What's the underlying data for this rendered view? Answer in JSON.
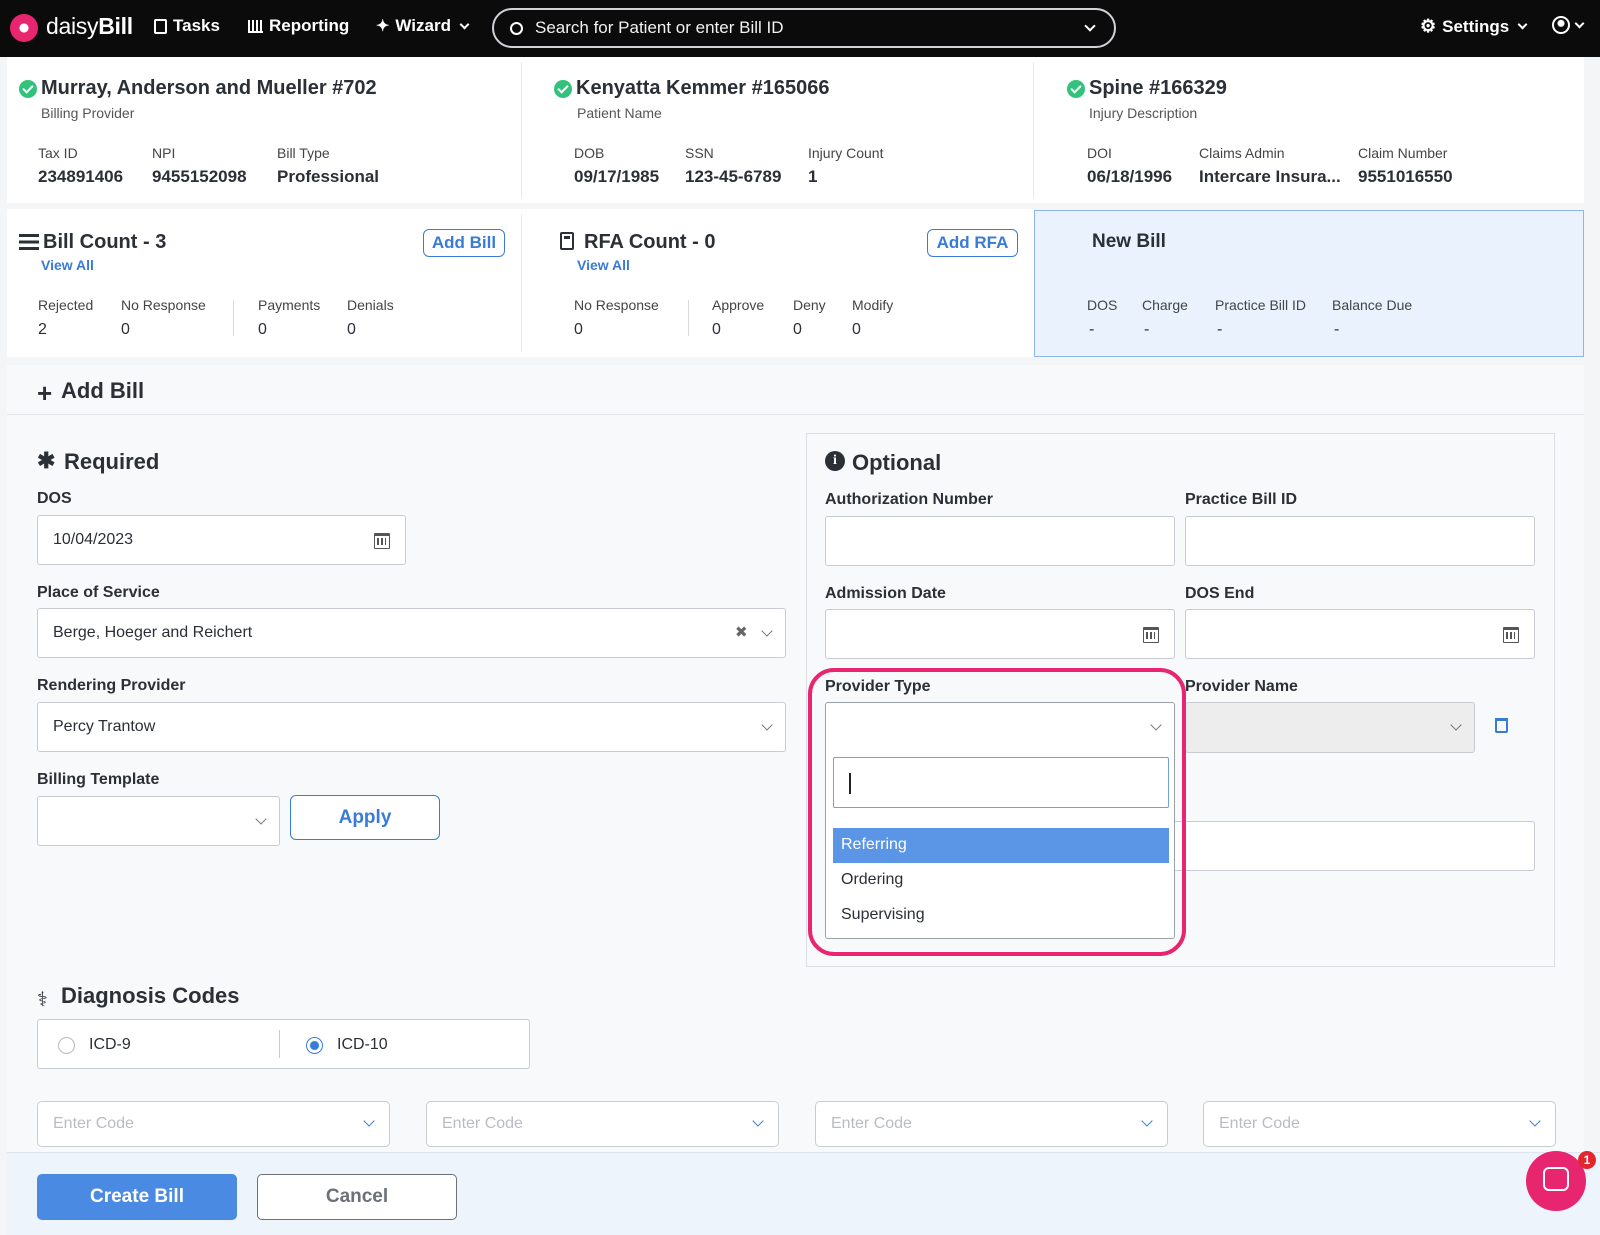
{
  "nav": {
    "brand_light": "daisy",
    "brand_bold": "Bill",
    "tasks": "Tasks",
    "reporting": "Reporting",
    "wizard": "Wizard",
    "search_placeholder": "Search for Patient or enter Bill ID",
    "settings": "Settings"
  },
  "summary": {
    "provider": {
      "title": "Murray, Anderson and Mueller #702",
      "subtitle": "Billing Provider",
      "fields": [
        {
          "label": "Tax ID",
          "value": "234891406"
        },
        {
          "label": "NPI",
          "value": "9455152098"
        },
        {
          "label": "Bill Type",
          "value": "Professional"
        }
      ]
    },
    "patient": {
      "title": "Kenyatta Kemmer #165066",
      "subtitle": "Patient Name",
      "fields": [
        {
          "label": "DOB",
          "value": "09/17/1985"
        },
        {
          "label": "SSN",
          "value": "123-45-6789"
        },
        {
          "label": "Injury Count",
          "value": "1"
        }
      ]
    },
    "injury": {
      "title": "Spine #166329",
      "subtitle": "Injury Description",
      "fields": [
        {
          "label": "DOI",
          "value": "06/18/1996"
        },
        {
          "label": "Claims Admin",
          "value": "Intercare Insura..."
        },
        {
          "label": "Claim Number",
          "value": "9551016550"
        }
      ]
    }
  },
  "counts": {
    "bills": {
      "title": "Bill Count - 3",
      "view_all": "View All",
      "add_button": "Add Bill",
      "stats": [
        {
          "label": "Rejected",
          "value": "2"
        },
        {
          "label": "No Response",
          "value": "0"
        },
        {
          "label": "Payments",
          "value": "0"
        },
        {
          "label": "Denials",
          "value": "0"
        }
      ]
    },
    "rfa": {
      "title": "RFA Count - 0",
      "view_all": "View All",
      "add_button": "Add RFA",
      "stats": [
        {
          "label": "No Response",
          "value": "0"
        },
        {
          "label": "Approve",
          "value": "0"
        },
        {
          "label": "Deny",
          "value": "0"
        },
        {
          "label": "Modify",
          "value": "0"
        }
      ]
    },
    "new_bill": {
      "title": "New Bill",
      "stats": [
        {
          "label": "DOS",
          "value": "-"
        },
        {
          "label": "Charge",
          "value": "-"
        },
        {
          "label": "Practice Bill ID",
          "value": "-"
        },
        {
          "label": "Balance Due",
          "value": "-"
        }
      ]
    }
  },
  "form": {
    "heading": "Add Bill",
    "required": {
      "heading": "Required",
      "dos_label": "DOS",
      "dos_value": "10/04/2023",
      "place_label": "Place of Service",
      "place_value": "Berge, Hoeger and Reichert",
      "rendering_label": "Rendering Provider",
      "rendering_value": "Percy Trantow",
      "template_label": "Billing Template",
      "apply": "Apply"
    },
    "optional": {
      "heading": "Optional",
      "auth_label": "Authorization Number",
      "practice_label": "Practice Bill ID",
      "admission_label": "Admission Date",
      "dos_end_label": "DOS End",
      "provider_type_label": "Provider Type",
      "provider_name_label": "Provider Name",
      "options": [
        "Referring",
        "Ordering",
        "Supervising"
      ]
    },
    "diagnosis": {
      "heading": "Diagnosis Codes",
      "icd9": "ICD-9",
      "icd10": "ICD-10",
      "code_placeholder": "Enter Code"
    }
  },
  "footer": {
    "create": "Create Bill",
    "cancel": "Cancel"
  },
  "chat": {
    "badge": "1"
  },
  "colors": {
    "accent": "#3a7bd5",
    "highlight": "#e8266f",
    "success": "#33c27c",
    "nav_bg": "#0b0b0c"
  }
}
